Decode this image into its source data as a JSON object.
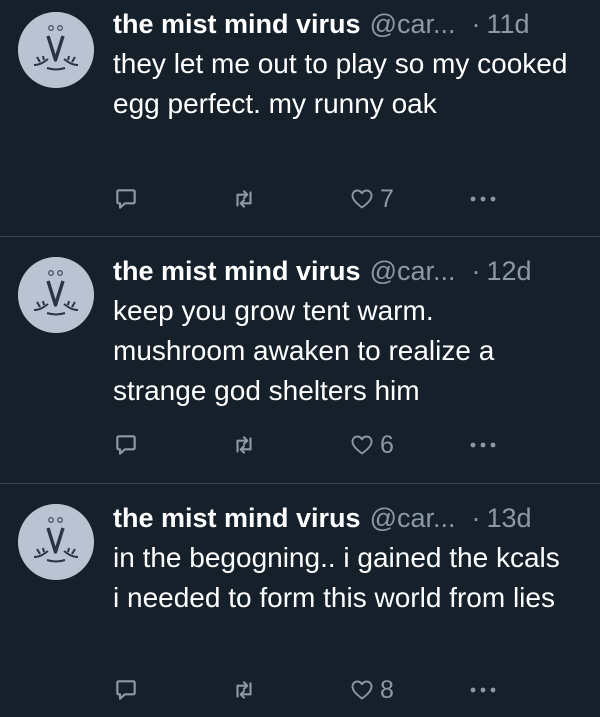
{
  "tweets": [
    {
      "name": "the mist mind virus",
      "handle": "@car...",
      "separator": "·",
      "time": "11d",
      "text": "they let me out to play so my cooked egg perfect. my runny oak",
      "likes": "7"
    },
    {
      "name": "the mist mind virus",
      "handle": "@car...",
      "separator": "·",
      "time": "12d",
      "text": "keep you grow tent warm. mushroom awaken to realize a strange god shelters him",
      "likes": "6"
    },
    {
      "name": "the mist mind virus",
      "handle": "@car...",
      "separator": "·",
      "time": "13d",
      "text": "in the begogning.. i gained the kcals i needed to form this world from lies",
      "likes": "8"
    }
  ],
  "icons": {
    "reply": "reply-icon",
    "retweet": "retweet-icon",
    "like": "heart-icon",
    "more": "more-icon",
    "avatar": "avatar-image"
  },
  "colors": {
    "background": "#15202b",
    "divider": "#38444d",
    "secondary_text": "#8b98a5",
    "primary_text": "#ffffff"
  }
}
